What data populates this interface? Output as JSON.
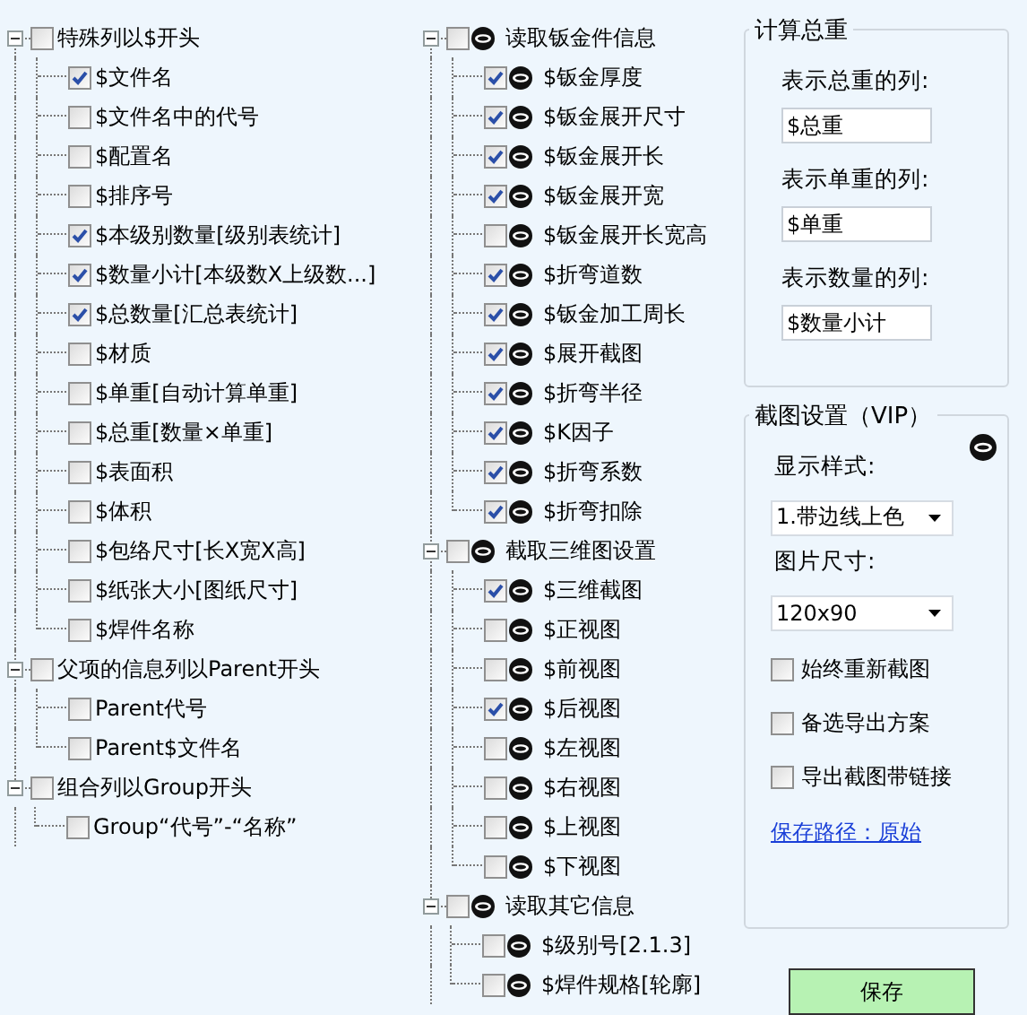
{
  "left_tree": [
    {
      "label": "特殊列以$开头",
      "checked": false,
      "expanded": true,
      "children": [
        {
          "label": "$文件名",
          "checked": true
        },
        {
          "label": "$文件名中的代号",
          "checked": false
        },
        {
          "label": "$配置名",
          "checked": false
        },
        {
          "label": "$排序号",
          "checked": false
        },
        {
          "label": "$本级别数量[级别表统计]",
          "checked": true
        },
        {
          "label": "$数量小计[本级数X上级数...]",
          "checked": true
        },
        {
          "label": "$总数量[汇总表统计]",
          "checked": true
        },
        {
          "label": "$材质",
          "checked": false
        },
        {
          "label": "$单重[自动计算单重]",
          "checked": false
        },
        {
          "label": "$总重[数量×单重]",
          "checked": false
        },
        {
          "label": "$表面积",
          "checked": false
        },
        {
          "label": "$体积",
          "checked": false
        },
        {
          "label": "$包络尺寸[长X宽X高]",
          "checked": false
        },
        {
          "label": "$纸张大小[图纸尺寸]",
          "checked": false
        },
        {
          "label": "$焊件名称",
          "checked": false
        }
      ]
    },
    {
      "label": "父项的信息列以Parent开头",
      "checked": false,
      "expanded": true,
      "children": [
        {
          "label": "Parent代号",
          "checked": false
        },
        {
          "label": "Parent$文件名",
          "checked": false
        }
      ]
    },
    {
      "label": "组合列以Group开头",
      "checked": false,
      "expanded": true,
      "children": [
        {
          "label": "Group“代号”-“名称”",
          "checked": false
        }
      ]
    }
  ],
  "middle_tree": [
    {
      "label": "读取钣金件信息",
      "checked": false,
      "expanded": true,
      "children": [
        {
          "label": "$钣金厚度",
          "checked": true
        },
        {
          "label": "$钣金展开尺寸",
          "checked": true
        },
        {
          "label": "$钣金展开长",
          "checked": true
        },
        {
          "label": "$钣金展开宽",
          "checked": true
        },
        {
          "label": "$钣金展开长宽高",
          "checked": false
        },
        {
          "label": "$折弯道数",
          "checked": true
        },
        {
          "label": "$钣金加工周长",
          "checked": true
        },
        {
          "label": "$展开截图",
          "checked": true
        },
        {
          "label": "$折弯半径",
          "checked": true
        },
        {
          "label": "$K因子",
          "checked": true
        },
        {
          "label": "$折弯系数",
          "checked": true
        },
        {
          "label": "$折弯扣除",
          "checked": true
        }
      ]
    },
    {
      "label": "截取三维图设置",
      "checked": false,
      "expanded": true,
      "children": [
        {
          "label": "$三维截图",
          "checked": true
        },
        {
          "label": "$正视图",
          "checked": false
        },
        {
          "label": "$前视图",
          "checked": false
        },
        {
          "label": "$后视图",
          "checked": true
        },
        {
          "label": "$左视图",
          "checked": false
        },
        {
          "label": "$右视图",
          "checked": false
        },
        {
          "label": "$上视图",
          "checked": false
        },
        {
          "label": "$下视图",
          "checked": false
        }
      ]
    },
    {
      "label": "读取其它信息",
      "checked": false,
      "expanded": true,
      "children": [
        {
          "label": "$级别号[2.1.3]",
          "checked": false
        },
        {
          "label": "$焊件规格[轮廓]",
          "checked": false
        }
      ]
    }
  ],
  "total_weight": {
    "title": "计算总重",
    "fields": [
      {
        "label": "表示总重的列:",
        "value": "$总重"
      },
      {
        "label": "表示单重的列:",
        "value": "$单重"
      },
      {
        "label": "表示数量的列:",
        "value": "$数量小计"
      }
    ]
  },
  "screenshot_settings": {
    "title": "截图设置（VIP）",
    "selects": [
      {
        "label": "显示样式:",
        "value": "1.带边线上色"
      },
      {
        "label": "图片尺寸:",
        "value": "120x90"
      }
    ],
    "options": [
      {
        "label": "始终重新截图",
        "checked": false
      },
      {
        "label": "备选导出方案",
        "checked": false
      },
      {
        "label": "导出截图带链接",
        "checked": false
      }
    ],
    "save_path_link": "保存路径：原始"
  },
  "save_button": "保存"
}
